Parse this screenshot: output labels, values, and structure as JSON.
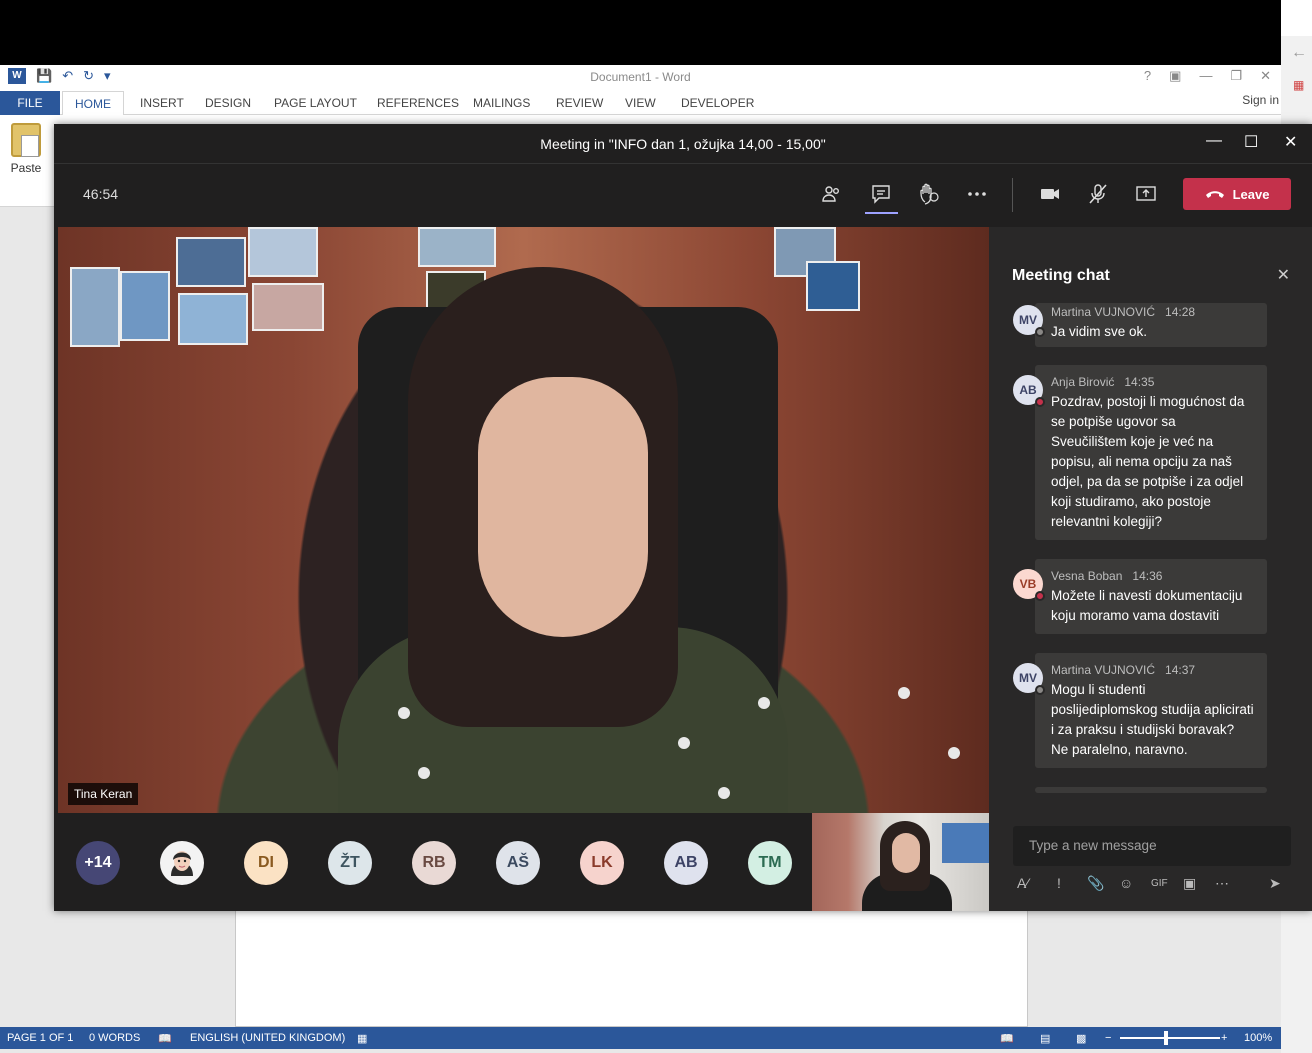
{
  "word": {
    "doc_title": "Document1 - Word",
    "tabs": [
      "FILE",
      "HOME",
      "INSERT",
      "DESIGN",
      "PAGE LAYOUT",
      "REFERENCES",
      "MAILINGS",
      "REVIEW",
      "VIEW",
      "DEVELOPER"
    ],
    "active_tab": "HOME",
    "sign_in": "Sign in",
    "paste_label": "Paste",
    "status": {
      "page": "PAGE 1 OF 1",
      "words": "0 WORDS",
      "language": "ENGLISH (UNITED KINGDOM)",
      "zoom": "100%"
    }
  },
  "teams": {
    "title": "Meeting in \"INFO dan 1, ožujka 14,00 - 15,00\"",
    "timer": "46:54",
    "leave_label": "Leave",
    "video_name": "Tina Keran",
    "participants": [
      {
        "initials": "+14",
        "bg": "#464775",
        "fg": "#ffffff"
      },
      {
        "initials": "",
        "bg": "#f3f3f3",
        "fg": "#333333",
        "photo": true
      },
      {
        "initials": "DI",
        "bg": "#fbe2c4",
        "fg": "#8a5a20"
      },
      {
        "initials": "ŽT",
        "bg": "#dde6ea",
        "fg": "#3e5560"
      },
      {
        "initials": "RB",
        "bg": "#e9d9d5",
        "fg": "#6a4a42"
      },
      {
        "initials": "AŠ",
        "bg": "#dfe3ea",
        "fg": "#3c4a60"
      },
      {
        "initials": "LK",
        "bg": "#f6d3cd",
        "fg": "#8a3a2a"
      },
      {
        "initials": "AB",
        "bg": "#dfe2ee",
        "fg": "#3d4366"
      },
      {
        "initials": "TM",
        "bg": "#d3efe3",
        "fg": "#2b6b52"
      }
    ],
    "chat": {
      "title": "Meeting chat",
      "placeholder": "Type a new message",
      "messages": [
        {
          "initials": "MV",
          "author": "Martina VUJNOVIĆ",
          "time": "14:28",
          "text": "Ja vidim sve ok.",
          "av_bg": "#dfe2ee",
          "av_fg": "#3d4366",
          "badge": "#8a8886"
        },
        {
          "initials": "AB",
          "author": "Anja Birović",
          "time": "14:35",
          "text": "Pozdrav, postoji li mogućnost da se potpiše ugovor sa Sveučilištem koje je već na popisu, ali nema opciju za naš odjel, pa da se potpiše i za odjel koji studiramo, ako postoje relevantni kolegiji?",
          "av_bg": "#dfe2ee",
          "av_fg": "#3d4366",
          "badge": "#c4314b"
        },
        {
          "initials": "VB",
          "author": "Vesna Boban",
          "time": "14:36",
          "text": "Možete li navesti dokumentaciju koju moramo vama dostaviti",
          "av_bg": "#fbd8d0",
          "av_fg": "#9a3d28",
          "badge": "#c4314b"
        },
        {
          "initials": "MV",
          "author": "Martina VUJNOVIĆ",
          "time": "14:37",
          "text": "Mogu li studenti poslijediplomskog studija aplicirati i za praksu i studijski boravak? Ne paralelno, naravno.",
          "av_bg": "#dfe2ee",
          "av_fg": "#3d4366",
          "badge": "#8a8886"
        }
      ]
    }
  }
}
